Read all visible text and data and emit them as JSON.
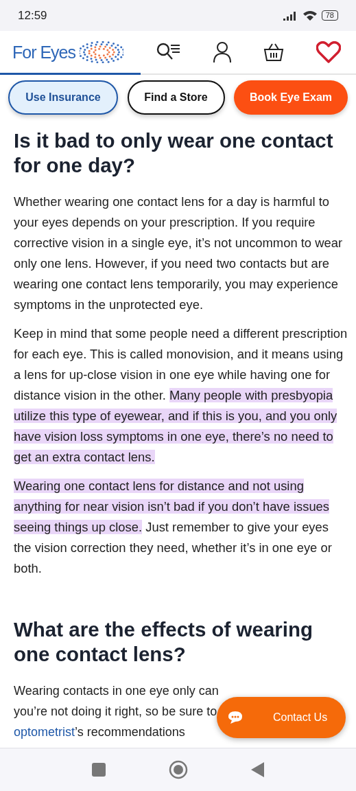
{
  "status_bar": {
    "time": "12:59",
    "battery": "78"
  },
  "header": {
    "logo": "For Eyes"
  },
  "actions": [
    {
      "label": "Use Insurance",
      "kind": "outline-blue"
    },
    {
      "label": "Find a Store",
      "kind": "outline"
    },
    {
      "label": "Book Eye Exam",
      "kind": "filled"
    }
  ],
  "sections": [
    {
      "heading": "Is it bad to only wear one contact for one day?",
      "paragraphs": [
        [
          {
            "text": "Whether wearing one contact lens for a day is harmful to your eyes depends on your prescription. If you require corrective vision in a single eye, it’s not uncommon to wear only one lens. However, if you need two contacts but are wearing one contact lens temporarily, you may experience symptoms in the unprotected eye.",
            "highlighted": false
          }
        ],
        [
          {
            "text": "Keep in mind that some people need a different prescription for each eye. This is called monovision, and it means using a lens for up-close vision in one eye while having one for distance vision in the other. ",
            "highlighted": false
          },
          {
            "text": "Many people with presbyopia utilize this type of eyewear, and if this is you, and you only have vision loss symptoms in one eye, there’s no need to get an extra contact lens.",
            "highlighted": true
          }
        ],
        [
          {
            "text": "Wearing one contact lens for distance and not using anything for near vision isn’t bad if you don’t have issues seeing things up close.",
            "highlighted": true
          },
          {
            "text": " Just remember to give your eyes the vision correction they need, whether it’s in one eye or both.",
            "highlighted": false
          }
        ]
      ]
    },
    {
      "heading": "What are the effects of wearing one contact lens?",
      "lines": [
        "Wearing contacts in one eye only can",
        "you’re not doing it right, so be sure to"
      ],
      "link": "optometrist",
      "link_tail": "’s recommendations"
    }
  ],
  "chat_button": {
    "label": "Contact Us"
  }
}
